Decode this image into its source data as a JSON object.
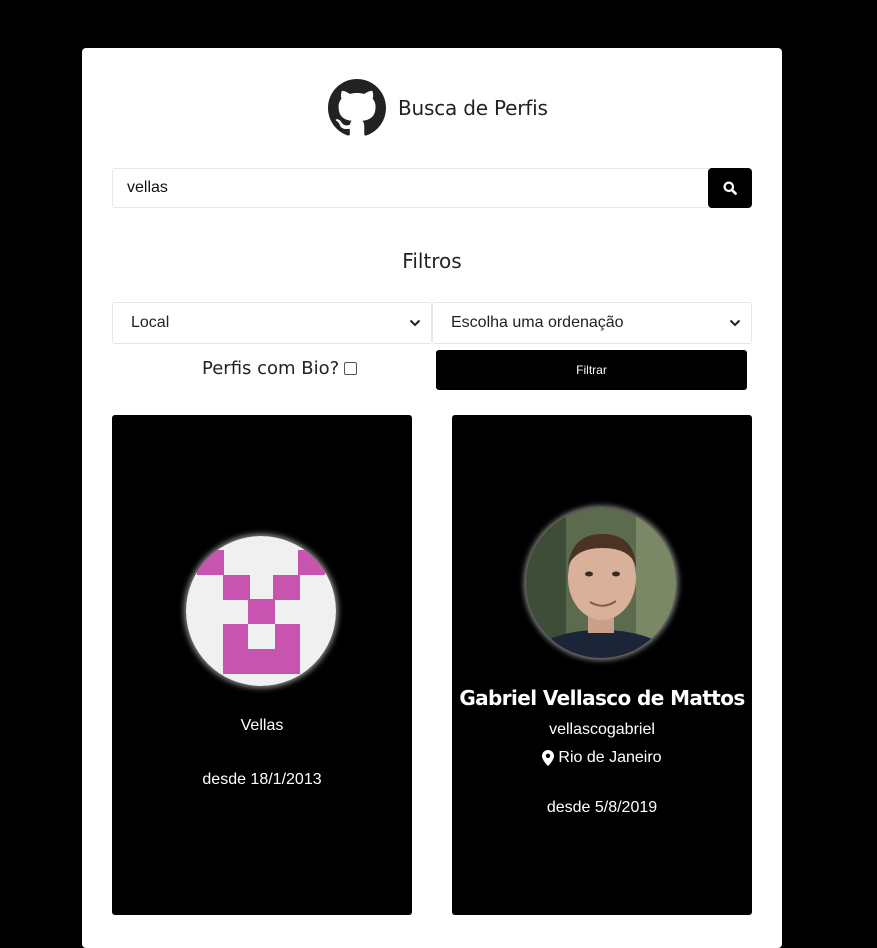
{
  "header": {
    "title": "Busca de Perfis",
    "logo_icon": "github-icon"
  },
  "search": {
    "value": "vellas",
    "button_icon": "search-icon"
  },
  "filters": {
    "title": "Filtros",
    "local_select": {
      "value": "Local"
    },
    "order_select": {
      "value": "Escolha uma ordenação"
    },
    "bio_label": "Perfis com Bio?",
    "bio_checked": false,
    "filter_button": "Filtrar"
  },
  "profiles": [
    {
      "name": "Vellas",
      "since": "desde 18/1/2013",
      "avatar_color": "#c755b0"
    },
    {
      "name": "Gabriel Vellasco de Mattos",
      "login": "vellascogabriel",
      "location": "Rio de Janeiro",
      "location_icon": "map-pin-icon",
      "since": "desde 5/8/2019"
    }
  ],
  "colors": {
    "background": "#000000",
    "panel": "#ffffff",
    "button": "#000000",
    "card": "#000000"
  }
}
